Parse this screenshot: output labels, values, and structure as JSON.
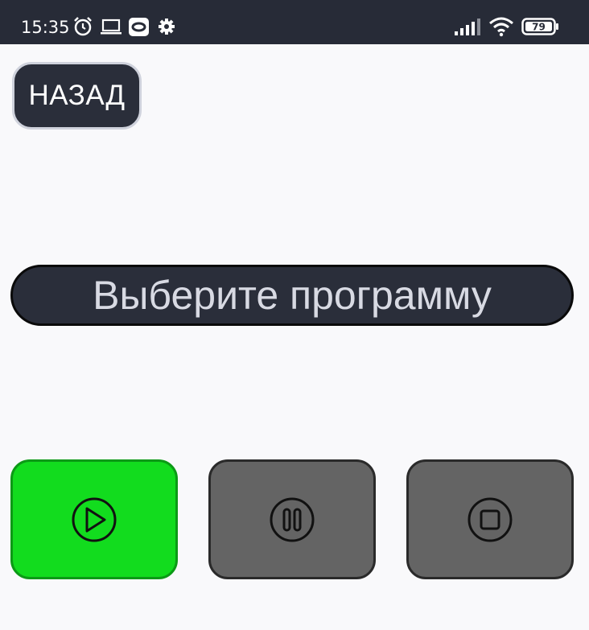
{
  "status_bar": {
    "time": "15:35",
    "battery": "79",
    "icons": [
      "alarm-icon",
      "laptop-icon",
      "cast-icon",
      "settings-icon",
      "signal-icon",
      "wifi-icon",
      "battery-icon"
    ]
  },
  "back_button": {
    "label": "НАЗАД"
  },
  "program_display": {
    "text": "Выберите программу"
  },
  "controls": [
    {
      "name": "play",
      "icon": "play-icon",
      "color": "#12dc1e"
    },
    {
      "name": "pause",
      "icon": "pause-icon",
      "color": "#646464"
    },
    {
      "name": "stop",
      "icon": "stop-icon",
      "color": "#646464"
    }
  ],
  "colors": {
    "status_bar_bg": "#272b37",
    "button_dark": "#2a2e3a",
    "active_green": "#12dc1e",
    "inactive_gray": "#646464",
    "background": "#f9f9fb"
  }
}
